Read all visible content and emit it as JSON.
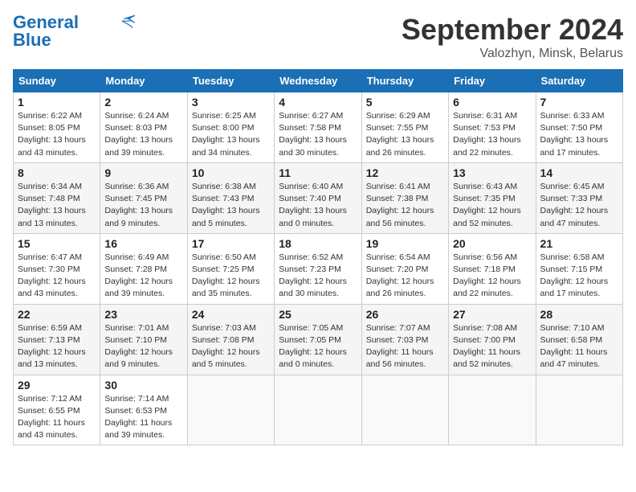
{
  "header": {
    "logo_line1": "General",
    "logo_line2": "Blue",
    "month_title": "September 2024",
    "location": "Valozhyn, Minsk, Belarus"
  },
  "weekdays": [
    "Sunday",
    "Monday",
    "Tuesday",
    "Wednesday",
    "Thursday",
    "Friday",
    "Saturday"
  ],
  "weeks": [
    [
      {
        "day": "1",
        "info": "Sunrise: 6:22 AM\nSunset: 8:05 PM\nDaylight: 13 hours\nand 43 minutes."
      },
      {
        "day": "2",
        "info": "Sunrise: 6:24 AM\nSunset: 8:03 PM\nDaylight: 13 hours\nand 39 minutes."
      },
      {
        "day": "3",
        "info": "Sunrise: 6:25 AM\nSunset: 8:00 PM\nDaylight: 13 hours\nand 34 minutes."
      },
      {
        "day": "4",
        "info": "Sunrise: 6:27 AM\nSunset: 7:58 PM\nDaylight: 13 hours\nand 30 minutes."
      },
      {
        "day": "5",
        "info": "Sunrise: 6:29 AM\nSunset: 7:55 PM\nDaylight: 13 hours\nand 26 minutes."
      },
      {
        "day": "6",
        "info": "Sunrise: 6:31 AM\nSunset: 7:53 PM\nDaylight: 13 hours\nand 22 minutes."
      },
      {
        "day": "7",
        "info": "Sunrise: 6:33 AM\nSunset: 7:50 PM\nDaylight: 13 hours\nand 17 minutes."
      }
    ],
    [
      {
        "day": "8",
        "info": "Sunrise: 6:34 AM\nSunset: 7:48 PM\nDaylight: 13 hours\nand 13 minutes."
      },
      {
        "day": "9",
        "info": "Sunrise: 6:36 AM\nSunset: 7:45 PM\nDaylight: 13 hours\nand 9 minutes."
      },
      {
        "day": "10",
        "info": "Sunrise: 6:38 AM\nSunset: 7:43 PM\nDaylight: 13 hours\nand 5 minutes."
      },
      {
        "day": "11",
        "info": "Sunrise: 6:40 AM\nSunset: 7:40 PM\nDaylight: 13 hours\nand 0 minutes."
      },
      {
        "day": "12",
        "info": "Sunrise: 6:41 AM\nSunset: 7:38 PM\nDaylight: 12 hours\nand 56 minutes."
      },
      {
        "day": "13",
        "info": "Sunrise: 6:43 AM\nSunset: 7:35 PM\nDaylight: 12 hours\nand 52 minutes."
      },
      {
        "day": "14",
        "info": "Sunrise: 6:45 AM\nSunset: 7:33 PM\nDaylight: 12 hours\nand 47 minutes."
      }
    ],
    [
      {
        "day": "15",
        "info": "Sunrise: 6:47 AM\nSunset: 7:30 PM\nDaylight: 12 hours\nand 43 minutes."
      },
      {
        "day": "16",
        "info": "Sunrise: 6:49 AM\nSunset: 7:28 PM\nDaylight: 12 hours\nand 39 minutes."
      },
      {
        "day": "17",
        "info": "Sunrise: 6:50 AM\nSunset: 7:25 PM\nDaylight: 12 hours\nand 35 minutes."
      },
      {
        "day": "18",
        "info": "Sunrise: 6:52 AM\nSunset: 7:23 PM\nDaylight: 12 hours\nand 30 minutes."
      },
      {
        "day": "19",
        "info": "Sunrise: 6:54 AM\nSunset: 7:20 PM\nDaylight: 12 hours\nand 26 minutes."
      },
      {
        "day": "20",
        "info": "Sunrise: 6:56 AM\nSunset: 7:18 PM\nDaylight: 12 hours\nand 22 minutes."
      },
      {
        "day": "21",
        "info": "Sunrise: 6:58 AM\nSunset: 7:15 PM\nDaylight: 12 hours\nand 17 minutes."
      }
    ],
    [
      {
        "day": "22",
        "info": "Sunrise: 6:59 AM\nSunset: 7:13 PM\nDaylight: 12 hours\nand 13 minutes."
      },
      {
        "day": "23",
        "info": "Sunrise: 7:01 AM\nSunset: 7:10 PM\nDaylight: 12 hours\nand 9 minutes."
      },
      {
        "day": "24",
        "info": "Sunrise: 7:03 AM\nSunset: 7:08 PM\nDaylight: 12 hours\nand 5 minutes."
      },
      {
        "day": "25",
        "info": "Sunrise: 7:05 AM\nSunset: 7:05 PM\nDaylight: 12 hours\nand 0 minutes."
      },
      {
        "day": "26",
        "info": "Sunrise: 7:07 AM\nSunset: 7:03 PM\nDaylight: 11 hours\nand 56 minutes."
      },
      {
        "day": "27",
        "info": "Sunrise: 7:08 AM\nSunset: 7:00 PM\nDaylight: 11 hours\nand 52 minutes."
      },
      {
        "day": "28",
        "info": "Sunrise: 7:10 AM\nSunset: 6:58 PM\nDaylight: 11 hours\nand 47 minutes."
      }
    ],
    [
      {
        "day": "29",
        "info": "Sunrise: 7:12 AM\nSunset: 6:55 PM\nDaylight: 11 hours\nand 43 minutes."
      },
      {
        "day": "30",
        "info": "Sunrise: 7:14 AM\nSunset: 6:53 PM\nDaylight: 11 hours\nand 39 minutes."
      },
      {
        "day": "",
        "info": ""
      },
      {
        "day": "",
        "info": ""
      },
      {
        "day": "",
        "info": ""
      },
      {
        "day": "",
        "info": ""
      },
      {
        "day": "",
        "info": ""
      }
    ]
  ]
}
